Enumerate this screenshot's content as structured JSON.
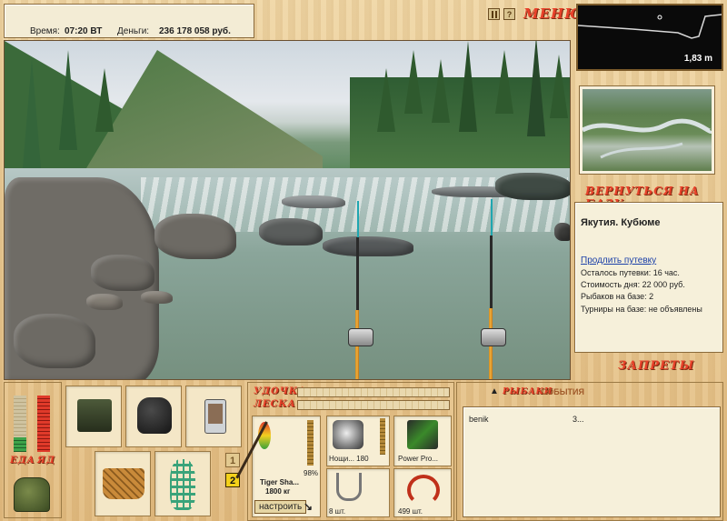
{
  "status": {
    "time_label": "Время:",
    "time_value": "07:20 ВТ",
    "money_label": "Деньги:",
    "money_value": "236 178 058 руб."
  },
  "menu": {
    "label": "МЕНЮ",
    "pause_icon": "pause-icon",
    "help_label": "?"
  },
  "depth": {
    "value": "1,83 m"
  },
  "location": {
    "return_label": "ВЕРНУТЬСЯ НА БАЗУ",
    "name": "Якутия. Кубюме",
    "extend_link": "Продлить путевку",
    "remaining": "Осталось путевки: 16 час.",
    "cost": "Стоимость дня: 22 000 руб.",
    "fishers": "Рыбаков на базе: 2",
    "tournaments": "Турниры на базе: не объявлены",
    "bans_label": "ЗАПРЕТЫ"
  },
  "meters": {
    "food_label": "ЕДА",
    "food_level": 0.25,
    "poison_label": "ЯД",
    "poison_level": 1.0
  },
  "rod_panel": {
    "rod_label": "УДОЧКА",
    "line_label": "ЛЕСКА",
    "rod_name": "Tiger Sha...",
    "rod_capacity": "1800 кг",
    "rod_condition": "98%",
    "setup_button": "настроить",
    "reel_name": "Нощи... 180",
    "reel_condition": "98%",
    "line_name": "Power Pro...",
    "hook_count": "8 шт.",
    "bait_count": "499 шт.",
    "slot1": "1",
    "slot2": "2"
  },
  "events": {
    "tab_fishers": "РЫБАКИ",
    "tab_events": "СОБЫТИЯ",
    "rows": [
      {
        "name": "benik",
        "value": "3..."
      }
    ]
  }
}
